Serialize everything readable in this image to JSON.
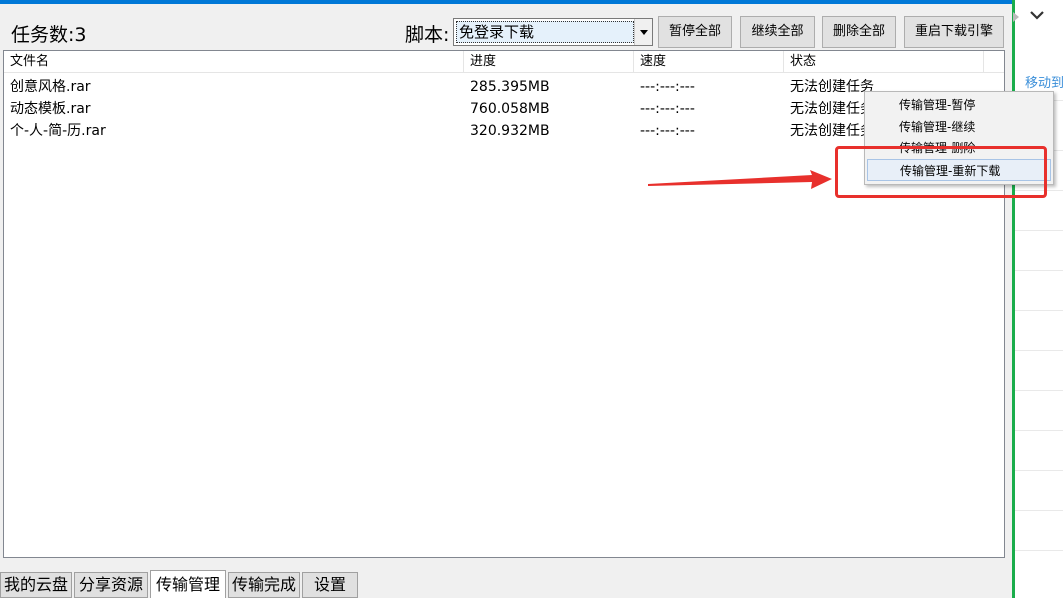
{
  "toolbar": {
    "task_count": "任务数:3",
    "script_label": "脚本:",
    "script_selected": "免登录下载",
    "buttons": [
      "暂停全部",
      "继续全部",
      "删除全部",
      "重启下载引擎"
    ]
  },
  "table": {
    "columns": [
      "文件名",
      "进度",
      "速度",
      "状态"
    ],
    "rows": [
      {
        "name": "创意风格.rar",
        "progress": "285.395MB",
        "speed": "---:---:---",
        "status": "无法创建任务"
      },
      {
        "name": "动态模板.rar",
        "progress": "760.058MB",
        "speed": "---:---:---",
        "status": "无法创建任务"
      },
      {
        "name": "个-人-简-历.rar",
        "progress": "320.932MB",
        "speed": "---:---:---",
        "status": "无法创建任务"
      }
    ]
  },
  "context_menu": {
    "items": [
      "传输管理-暂停",
      "传输管理-继续",
      "传输管理-删除",
      "传输管理-重新下载"
    ],
    "highlighted_index": 3
  },
  "tabs": {
    "items": [
      "我的云盘",
      "分享资源",
      "传输管理",
      "传输完成",
      "设置"
    ],
    "active_index": 2
  },
  "side_panel": {
    "move_label": "移动到"
  },
  "colors": {
    "accent_top": "#0078d7",
    "green_border": "#1aad4b",
    "annotation_red": "#e8302c",
    "link_blue": "#3b8fd9"
  },
  "icons": {
    "dropdown": "chevron-down-icon",
    "combo_arrow": "triangle-down-icon"
  }
}
